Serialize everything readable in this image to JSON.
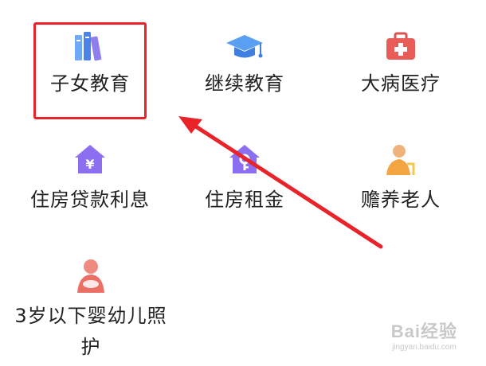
{
  "categories": [
    {
      "id": "children-education",
      "label": "子女教育",
      "icon": "books-icon"
    },
    {
      "id": "continuing-education",
      "label": "继续教育",
      "icon": "graduation-cap-icon"
    },
    {
      "id": "serious-illness",
      "label": "大病医疗",
      "icon": "medical-kit-icon"
    },
    {
      "id": "housing-loan-interest",
      "label": "住房贷款利息",
      "icon": "house-yuan-icon"
    },
    {
      "id": "housing-rent",
      "label": "住房租金",
      "icon": "house-key-icon"
    },
    {
      "id": "elderly-support",
      "label": "赡养老人",
      "icon": "elderly-person-icon"
    },
    {
      "id": "infant-care",
      "label_line1": "3岁以下婴幼儿照",
      "label_line2": "护",
      "icon": "mother-baby-icon"
    }
  ],
  "annotation": {
    "highlighted": "子女教育",
    "color": "#e8232a"
  },
  "watermark": {
    "brand": "Bai经验",
    "sub": "jingyan.baidu.com"
  }
}
